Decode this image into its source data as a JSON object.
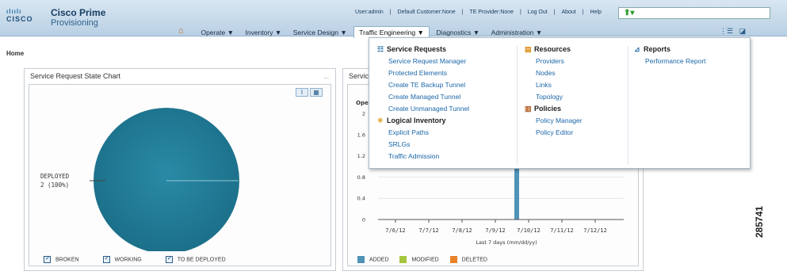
{
  "header": {
    "logo_bars": "ılıılı",
    "logo_cisco": "CISCO",
    "product": "Cisco Prime",
    "subtitle": "Provisioning",
    "links": [
      "User:admin",
      "|",
      "Default Customer:None",
      "|",
      "TE Provider:None",
      "|",
      "Log Out",
      "|",
      "About",
      "|",
      "Help"
    ],
    "search_icon": "green-up-arrow-icon"
  },
  "nav": {
    "home_icon": "home-icon",
    "items": [
      "Operate ▼",
      "Inventory ▼",
      "Service Design ▼",
      "Traffic Engineering ▼",
      "Diagnostics ▼",
      "Administration ▼"
    ],
    "active": "Traffic Engineering ▼"
  },
  "breadcrumb": "Home",
  "left_panel": {
    "title": "Service Request State Chart",
    "minimize": "...",
    "pie_label_line1": "DEPLOYED",
    "pie_label_line2": "2 (100%)",
    "legend": [
      "BROKEN",
      "WORKING",
      "TO BE DEPLOYED"
    ]
  },
  "right_panel": {
    "title": "Servic",
    "partial_label": "Oper",
    "legend": [
      {
        "label": "ADDED",
        "color": "#4f93b8"
      },
      {
        "label": "MODIFIED",
        "color": "#a4c63d"
      },
      {
        "label": "DELETED",
        "color": "#e8832a"
      }
    ]
  },
  "chart_data": {
    "type": "bar",
    "categories": [
      "7/6/12",
      "7/7/12",
      "7/8/12",
      "7/9/12",
      "7/10/12",
      "7/11/12",
      "7/12/12"
    ],
    "series": [
      {
        "name": "ADDED",
        "values": [
          0,
          0,
          0,
          0,
          2,
          0,
          0
        ]
      },
      {
        "name": "MODIFIED",
        "values": [
          0,
          0,
          0,
          0,
          0,
          0,
          0
        ]
      },
      {
        "name": "DELETED",
        "values": [
          0,
          0,
          0,
          0,
          0,
          0,
          0
        ]
      }
    ],
    "yticks": [
      "0",
      "0.4",
      "0.8",
      "1.2",
      "1.6",
      "2"
    ],
    "ylim": [
      0,
      2
    ],
    "xlabel": "Last 7 days (mm/dd/yy)",
    "ylabel": ""
  },
  "menu": {
    "col1": {
      "sections": [
        {
          "title": "Service Requests",
          "icon": "service-requests-icon",
          "items": [
            "Service Request Manager",
            "Protected Elements",
            "Create TE Backup Tunnel",
            "Create Managed Tunnel",
            "Create Unmanaged Tunnel"
          ]
        },
        {
          "title": "Logical Inventory",
          "icon": "logical-inventory-icon",
          "items": [
            "Explicit Paths",
            "SRLGs",
            "Traffic Admission"
          ]
        }
      ]
    },
    "col2": {
      "sections": [
        {
          "title": "Resources",
          "icon": "resources-icon",
          "items": [
            "Providers",
            "Nodes",
            "Links",
            "Topology"
          ]
        },
        {
          "title": "Policies",
          "icon": "policies-icon",
          "items": [
            "Policy Manager",
            "Policy Editor"
          ]
        }
      ]
    },
    "col3": {
      "sections": [
        {
          "title": "Reports",
          "icon": "reports-icon",
          "items": [
            "Performance Report"
          ]
        }
      ]
    }
  },
  "figure_id": "285741"
}
